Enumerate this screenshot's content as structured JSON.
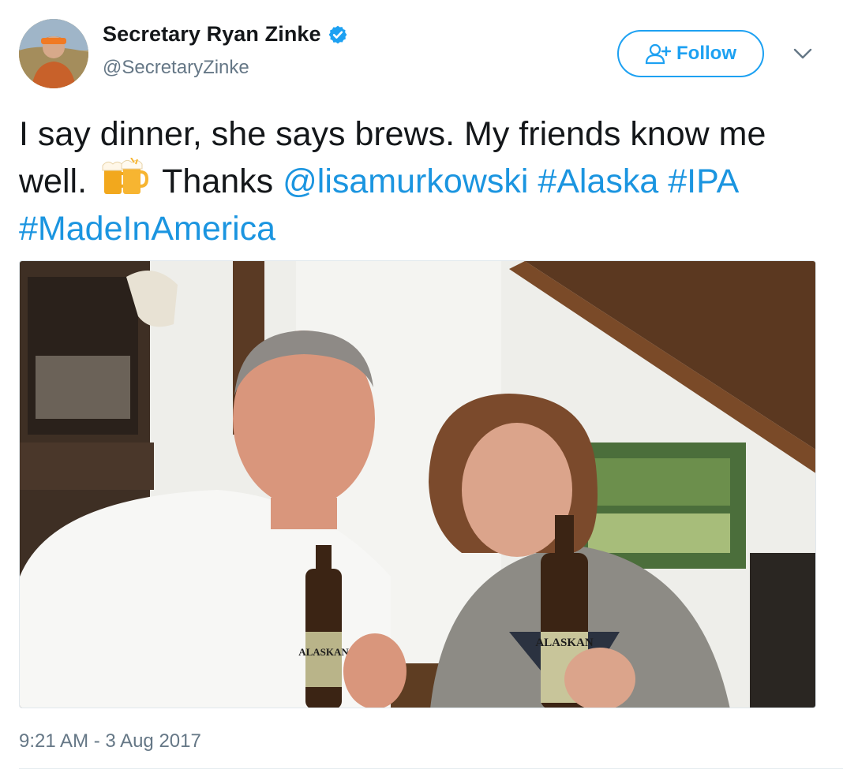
{
  "user": {
    "display_name": "Secretary Ryan Zinke",
    "handle": "@SecretaryZinke",
    "verified": true
  },
  "follow_button": {
    "label": "Follow"
  },
  "tweet": {
    "text_part1": "I say dinner, she says brews. My friends know me well.",
    "emoji": "beers-emoji",
    "text_part2": "Thanks",
    "mention": "@lisamurkowski",
    "hashtags": [
      "#Alaska",
      "#IPA",
      "#MadeInAmerica"
    ],
    "bottle_label_left": "ALASKAN",
    "bottle_label_right": "ALASKAN"
  },
  "timestamp": "9:21 AM - 3 Aug 2017",
  "colors": {
    "link": "#1b95e0",
    "accent": "#1da1f2",
    "muted": "#657786"
  }
}
